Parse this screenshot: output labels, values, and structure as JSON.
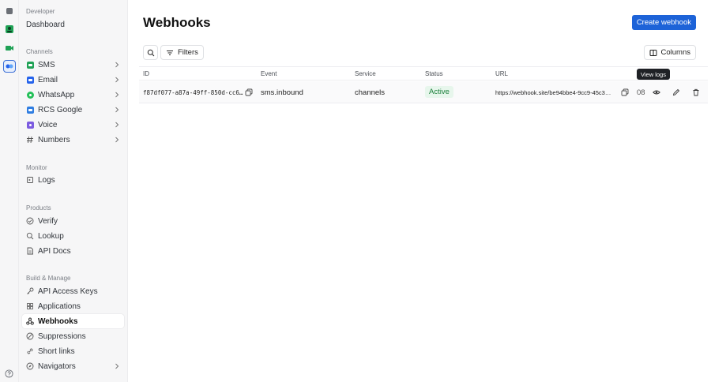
{
  "sidebar": {
    "developer_label": "Developer",
    "dashboard": "Dashboard",
    "channels_label": "Channels",
    "channels": [
      {
        "label": "SMS",
        "color": "#1fa155"
      },
      {
        "label": "Email",
        "color": "#2563eb"
      },
      {
        "label": "WhatsApp",
        "color": "#25c05a"
      },
      {
        "label": "RCS Google",
        "color": "#2f7de1"
      },
      {
        "label": "Voice",
        "color": "#7c5ce0"
      },
      {
        "label": "Numbers",
        "color": ""
      }
    ],
    "monitor_label": "Monitor",
    "logs": "Logs",
    "products_label": "Products",
    "verify": "Verify",
    "lookup": "Lookup",
    "api_docs": "API Docs",
    "build_label": "Build & Manage",
    "api_access_keys": "API Access Keys",
    "applications": "Applications",
    "webhooks": "Webhooks",
    "suppressions": "Suppressions",
    "short_links": "Short links",
    "navigators": "Navigators"
  },
  "main": {
    "title": "Webhooks",
    "create_button": "Create webhook",
    "filters_button": "Filters",
    "columns_button": "Columns",
    "columns": [
      "ID",
      "Event",
      "Service",
      "Status",
      "URL"
    ],
    "row": {
      "id": "f87df077-a87a-49ff-850d-cc6…",
      "event": "sms.inbound",
      "service": "channels",
      "status": "Active",
      "url": "https://webhook.site/be94bbe4-9cc9-45c3…",
      "overflow": "08"
    },
    "tooltip": "View logs"
  },
  "colors": {
    "accent": "#1d63d8",
    "status_active_bg": "#e7f6ec",
    "status_active_text": "#1b7f3b"
  }
}
